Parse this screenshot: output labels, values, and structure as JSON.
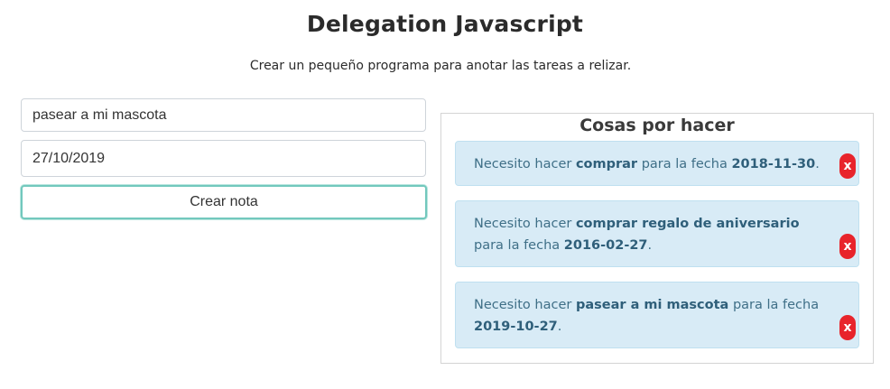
{
  "header": {
    "title": "Delegation Javascript",
    "subtitle": "Crear un pequeño programa para anotar las tareas a relizar."
  },
  "form": {
    "task_value": "pasear a mi mascota",
    "date_value": "27/10/2019",
    "create_label": "Crear nota"
  },
  "notes": {
    "title": "Cosas por hacer",
    "delete_label": "x",
    "items": [
      {
        "prefix": "Necesito hacer",
        "task": "comprar",
        "middle": "para la fecha",
        "date": "2018-11-30",
        "end": "."
      },
      {
        "prefix": "Necesito hacer",
        "task": "comprar regalo de aniversario",
        "middle": "para la fecha",
        "date": "2016-02-27",
        "end": "."
      },
      {
        "prefix": "Necesito hacer",
        "task": "pasear a mi mascota",
        "middle": "para la fecha",
        "date": "2019-10-27",
        "end": "."
      }
    ]
  },
  "colors": {
    "note_bg": "#d8ebf6",
    "note_text": "#3f6f87",
    "delete_red": "#e8242b",
    "focus_border": "#72c8bd"
  }
}
